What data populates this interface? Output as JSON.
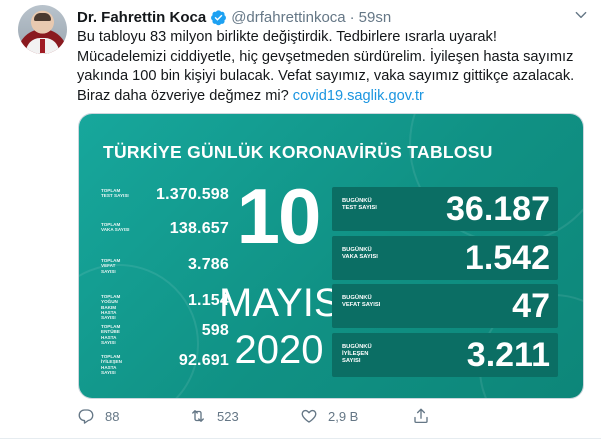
{
  "author": {
    "name": "Dr. Fahrettin Koca",
    "handle": "@drfahrettinkoca",
    "separator": "·",
    "time": "59sn"
  },
  "tweet": {
    "lines": [
      "Bu tabloyu 83 milyon birlikte değiştirdik. Tedbirlere ısrarla uyarak!",
      "Mücadelemizi ciddiyetle, hiç gevşetmeden sürdürelim. İyileşen hasta sayımız",
      "yakında 100 bin kişiyi bulacak. Vefat sayımız, vaka sayımız gittikçe azalacak."
    ],
    "last_line_text": "Biraz daha özveriye değmez mi? ",
    "link_text": "covid19.saglik.gov.tr"
  },
  "card": {
    "title": "TÜRKİYE GÜNLÜK KORONAVİRÜS TABLOSU",
    "day": "10",
    "month": "MAYIS",
    "year": "2020",
    "totals": [
      {
        "label": "TOPLAM TEST SAYISI",
        "value": "1.370.598"
      },
      {
        "label": "TOPLAM VAKA SAYISI",
        "value": "138.657"
      },
      {
        "label": "TOPLAM VEFAT SAYISI",
        "value": "3.786"
      },
      {
        "label": "TOPLAM YOĞUN BAKIM HASTA SAYISI",
        "value": "1.154"
      },
      {
        "label": "TOPLAM ENTÜBE HASTA SAYISI",
        "value": "598"
      },
      {
        "label": "TOPLAM İYİLEŞEN HASTA SAYISI",
        "value": "92.691"
      }
    ],
    "daily": [
      {
        "label": "BUGÜNKÜ TEST SAYISI",
        "value": "36.187"
      },
      {
        "label": "BUGÜNKÜ VAKA SAYISI",
        "value": "1.542"
      },
      {
        "label": "BUGÜNKÜ VEFAT SAYISI",
        "value": "47"
      },
      {
        "label": "BUGÜNKÜ İYİLEŞEN SAYISI",
        "value": "3.211"
      }
    ]
  },
  "actions": {
    "reply_count": "88",
    "retweet_count": "523",
    "like_count": "2,9 B"
  },
  "colors": {
    "accent": "#1b95e0",
    "card_teal": "#109184",
    "card_box": "#0b6e64",
    "muted": "#657786"
  },
  "icons": [
    "verified-badge-icon",
    "chevron-down-icon",
    "reply-icon",
    "retweet-icon",
    "like-icon",
    "share-icon"
  ]
}
